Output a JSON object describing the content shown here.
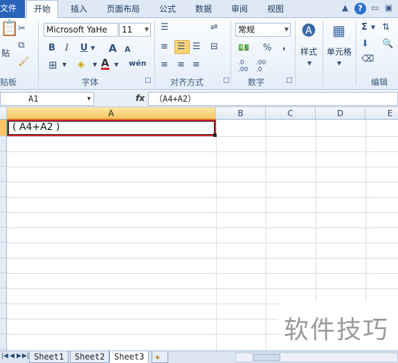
{
  "tabs": {
    "file": "文件",
    "items": [
      "开始",
      "插入",
      "页面布局",
      "公式",
      "数据",
      "审阅",
      "视图"
    ],
    "active": "开始"
  },
  "ribbon": {
    "clipboard": {
      "paste": "贴",
      "label": "贴板"
    },
    "font": {
      "name": "Microsoft YaHe",
      "size": "11",
      "label": "字体",
      "bold": "B",
      "italic": "I",
      "underline": "U",
      "grow": "A",
      "shrink": "A",
      "font_color": "A",
      "wen": "wén"
    },
    "alignment": {
      "label": "对齐方式"
    },
    "number": {
      "format": "常规",
      "label": "数字",
      "percent": "%",
      "comma": ",",
      "inc_decimal": ".0 .00",
      "dec_decimal": ".00 .0"
    },
    "styles": {
      "label": "样式"
    },
    "cells": {
      "label": "单元格"
    },
    "editing": {
      "label": "编辑",
      "sum": "Σ"
    }
  },
  "formula_bar": {
    "name_box": "A1",
    "fx": "fx",
    "content": "（A4+A2）"
  },
  "grid": {
    "columns": [
      "A",
      "B",
      "C",
      "D",
      "E"
    ],
    "active_cell_value": "( A4+A2 )"
  },
  "sheets": {
    "tabs": [
      "Sheet1",
      "Sheet2",
      "Sheet3"
    ],
    "active": "Sheet3"
  },
  "watermark": "软件技巧",
  "colors": {
    "file_tab": "#2a64b8",
    "active_cell_border": "#d8222a",
    "selected_header": "#f5c660"
  }
}
